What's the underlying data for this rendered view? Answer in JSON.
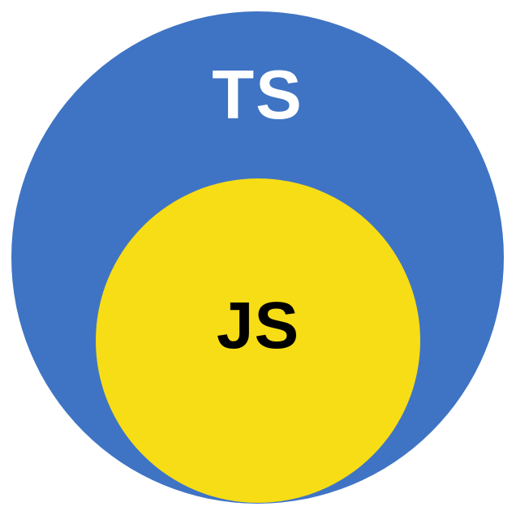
{
  "diagram": {
    "outer": {
      "label": "TS",
      "color": "#3F74C4",
      "label_color": "#FFFFFF"
    },
    "inner": {
      "label": "JS",
      "color": "#F7DD16",
      "label_color": "#000000"
    }
  },
  "chart_data": {
    "type": "venn-subset",
    "title": "",
    "sets": [
      {
        "name": "TS",
        "color": "#3F74C4",
        "contains": [
          "JS"
        ]
      },
      {
        "name": "JS",
        "color": "#F7DD16",
        "contains": []
      }
    ],
    "relation": "JS is a subset of TS"
  }
}
